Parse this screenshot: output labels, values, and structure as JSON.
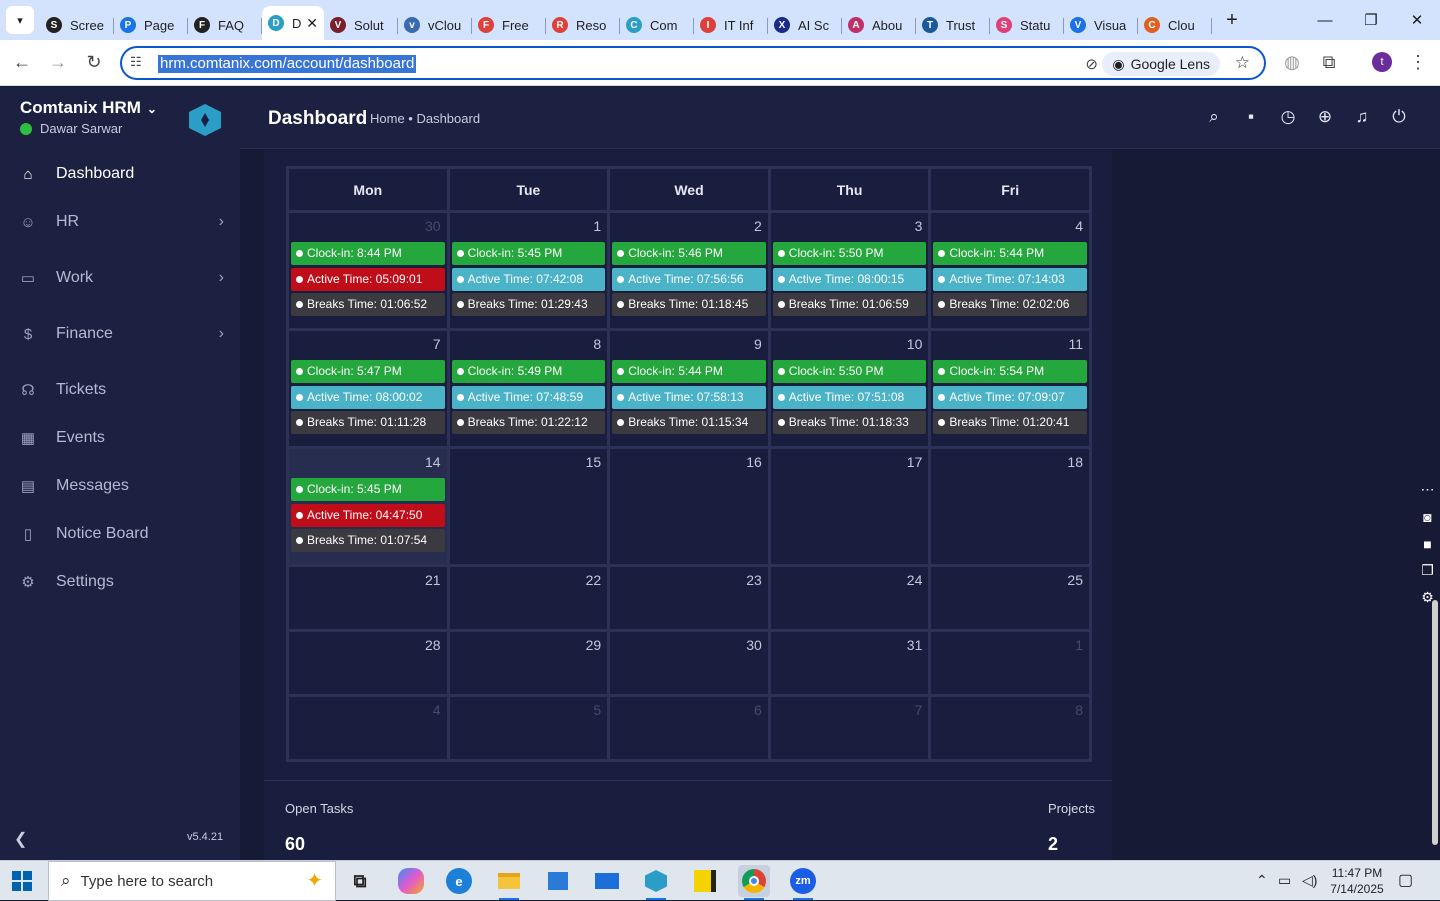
{
  "browser": {
    "tabs": [
      {
        "label": "Scree",
        "fav": "S",
        "color": "#222222"
      },
      {
        "label": "Page",
        "fav": "P",
        "color": "#1a73e8"
      },
      {
        "label": "FAQ",
        "fav": "F",
        "color": "#222222"
      },
      {
        "label": "D",
        "fav": "D",
        "color": "#2b9ec8",
        "active": true
      },
      {
        "label": "Solut",
        "fav": "V",
        "color": "#7b1f2d"
      },
      {
        "label": "vClou",
        "fav": "v",
        "color": "#3a6ab0"
      },
      {
        "label": "Free",
        "fav": "F",
        "color": "#e0403a"
      },
      {
        "label": "Reso",
        "fav": "R",
        "color": "#e0403a"
      },
      {
        "label": "Com",
        "fav": "C",
        "color": "#2b9ec8"
      },
      {
        "label": "IT Inf",
        "fav": "I",
        "color": "#e0403a"
      },
      {
        "label": "AI Sc",
        "fav": "X",
        "color": "#1a2a8a"
      },
      {
        "label": "Abou",
        "fav": "A",
        "color": "#c0306a"
      },
      {
        "label": "Trust",
        "fav": "T",
        "color": "#1a5a9a"
      },
      {
        "label": "Statu",
        "fav": "S",
        "color": "#e0407a"
      },
      {
        "label": "Visua",
        "fav": "V",
        "color": "#1a73e8"
      },
      {
        "label": "Clou",
        "fav": "C",
        "color": "#e06020"
      }
    ],
    "url": "hrm.comtanix.com/account/dashboard",
    "lens_label": "Google Lens",
    "profile_initial": "t"
  },
  "sidebar": {
    "brand": "Comtanix HRM",
    "user": "Dawar Sarwar",
    "items": [
      {
        "label": "Dashboard",
        "icon": "home-icon",
        "glyph": "⌂"
      },
      {
        "label": "HR",
        "icon": "users-icon",
        "glyph": "☺"
      },
      {
        "label": "Work",
        "icon": "briefcase-icon",
        "glyph": "▭"
      },
      {
        "label": "Finance",
        "icon": "dollar-icon",
        "glyph": "$"
      },
      {
        "label": "Tickets",
        "icon": "headset-icon",
        "glyph": "☊"
      },
      {
        "label": "Events",
        "icon": "calendar-icon",
        "glyph": "▦"
      },
      {
        "label": "Messages",
        "icon": "message-icon",
        "glyph": "▤"
      },
      {
        "label": "Notice Board",
        "icon": "clipboard-icon",
        "glyph": "▯"
      },
      {
        "label": "Settings",
        "icon": "gear-icon",
        "glyph": "⚙"
      }
    ],
    "version": "v5.4.21"
  },
  "header": {
    "title": "Dashboard",
    "breadcrumb": "Home • Dashboard"
  },
  "calendar": {
    "days": [
      "Mon",
      "Tue",
      "Wed",
      "Thu",
      "Fri"
    ],
    "weeks": [
      [
        {
          "day": "30",
          "other": true,
          "clock_in": "Clock-in: 8:44 PM",
          "active": "Active Time: 05:09:01",
          "warn": true,
          "breaks": "Breaks Time: 01:06:52"
        },
        {
          "day": "1",
          "clock_in": "Clock-in: 5:45 PM",
          "active": "Active Time: 07:42:08",
          "breaks": "Breaks Time: 01:29:43"
        },
        {
          "day": "2",
          "clock_in": "Clock-in: 5:46 PM",
          "active": "Active Time: 07:56:56",
          "breaks": "Breaks Time: 01:18:45"
        },
        {
          "day": "3",
          "clock_in": "Clock-in: 5:50 PM",
          "active": "Active Time: 08:00:15",
          "breaks": "Breaks Time: 01:06:59"
        },
        {
          "day": "4",
          "clock_in": "Clock-in: 5:44 PM",
          "active": "Active Time: 07:14:03",
          "breaks": "Breaks Time: 02:02:06"
        }
      ],
      [
        {
          "day": "7",
          "clock_in": "Clock-in: 5:47 PM",
          "active": "Active Time: 08:00:02",
          "breaks": "Breaks Time: 01:11:28"
        },
        {
          "day": "8",
          "clock_in": "Clock-in: 5:49 PM",
          "active": "Active Time: 07:48:59",
          "breaks": "Breaks Time: 01:22:12"
        },
        {
          "day": "9",
          "clock_in": "Clock-in: 5:44 PM",
          "active": "Active Time: 07:58:13",
          "breaks": "Breaks Time: 01:15:34"
        },
        {
          "day": "10",
          "clock_in": "Clock-in: 5:50 PM",
          "active": "Active Time: 07:51:08",
          "breaks": "Breaks Time: 01:18:33"
        },
        {
          "day": "11",
          "clock_in": "Clock-in: 5:54 PM",
          "active": "Active Time: 07:09:07",
          "breaks": "Breaks Time: 01:20:41"
        }
      ],
      [
        {
          "day": "14",
          "today": true,
          "clock_in": "Clock-in: 5:45 PM",
          "active": "Active Time: 04:47:50",
          "warn": true,
          "breaks": "Breaks Time: 01:07:54"
        },
        {
          "day": "15"
        },
        {
          "day": "16"
        },
        {
          "day": "17"
        },
        {
          "day": "18"
        }
      ],
      [
        {
          "day": "21"
        },
        {
          "day": "22"
        },
        {
          "day": "23"
        },
        {
          "day": "24"
        },
        {
          "day": "25"
        }
      ],
      [
        {
          "day": "28"
        },
        {
          "day": "29"
        },
        {
          "day": "30"
        },
        {
          "day": "31"
        },
        {
          "day": "1",
          "other": true
        }
      ],
      [
        {
          "day": "4",
          "other": true
        },
        {
          "day": "5",
          "other": true
        },
        {
          "day": "6",
          "other": true
        },
        {
          "day": "7",
          "other": true
        },
        {
          "day": "8",
          "other": true
        }
      ]
    ]
  },
  "stats": {
    "open_tasks_label": "Open Tasks",
    "open_tasks_value": "60",
    "projects_label": "Projects",
    "projects_value": "2"
  },
  "taskbar": {
    "search_placeholder": "Type here to search",
    "time": "11:47 PM",
    "date": "7/14/2025"
  },
  "colors": {
    "clock_in": "#24a73c",
    "active_time": "#4bb3c8",
    "active_time_warn": "#c00d1a",
    "breaks": "#3a3a40",
    "sidebar": "#1c2141",
    "content": "#161a35"
  }
}
